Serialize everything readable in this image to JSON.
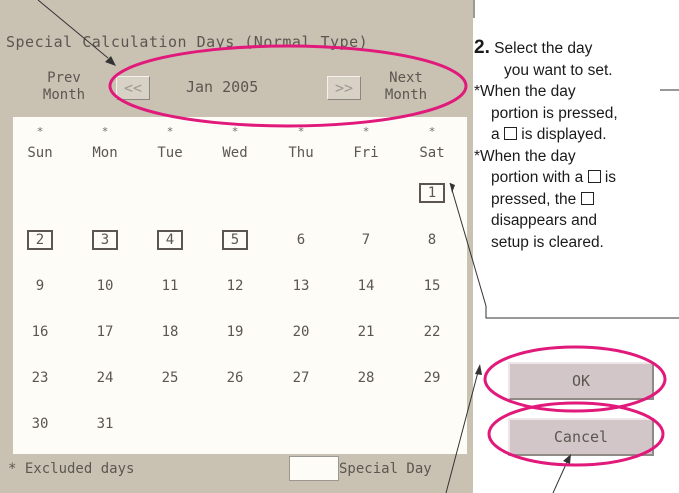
{
  "screen": {
    "title": "Special Calculation Days (Normal Type)",
    "prev_month_label": "Prev Month",
    "next_month_label": "Next Month",
    "prev_arrow": "<<",
    "next_arrow": ">>",
    "current_month": "Jan 2005",
    "weekday_marker": "*",
    "weekdays": [
      "Sun",
      "Mon",
      "Tue",
      "Wed",
      "Thu",
      "Fri",
      "Sat"
    ],
    "weeks": [
      [
        "",
        "",
        "",
        "",
        "",
        "",
        "1"
      ],
      [
        "2",
        "3",
        "4",
        "5",
        "6",
        "7",
        "8"
      ],
      [
        "9",
        "10",
        "11",
        "12",
        "13",
        "14",
        "15"
      ],
      [
        "16",
        "17",
        "18",
        "19",
        "20",
        "21",
        "22"
      ],
      [
        "23",
        "24",
        "25",
        "26",
        "27",
        "28",
        "29"
      ],
      [
        "30",
        "31",
        "",
        "",
        "",
        "",
        ""
      ]
    ],
    "selected_days": [
      "1",
      "2",
      "3",
      "4",
      "5"
    ],
    "ok_label": "OK",
    "cancel_label": "Cancel",
    "legend_excluded": "* Excluded days",
    "legend_special": "Special Day"
  },
  "annotation": {
    "step_number": "2.",
    "step_text": "Select the day",
    "step_text_2": "you want to set.",
    "note1_line1": "*When the day",
    "note1_line2": "portion is pressed,",
    "note1_line3_a": "a",
    "note1_line3_b": "is displayed.",
    "note2_line1": "*When the day",
    "note2_line2_a": "portion with a",
    "note2_line2_b": "is",
    "note2_line3_a": "pressed, the",
    "note2_line4": "disappears and",
    "note2_line5": "setup is cleared."
  },
  "colors": {
    "panel": "#c9c2b3",
    "calendar": "#fdfcf7",
    "highlight": "#e0197a",
    "text": "#5b5750"
  }
}
